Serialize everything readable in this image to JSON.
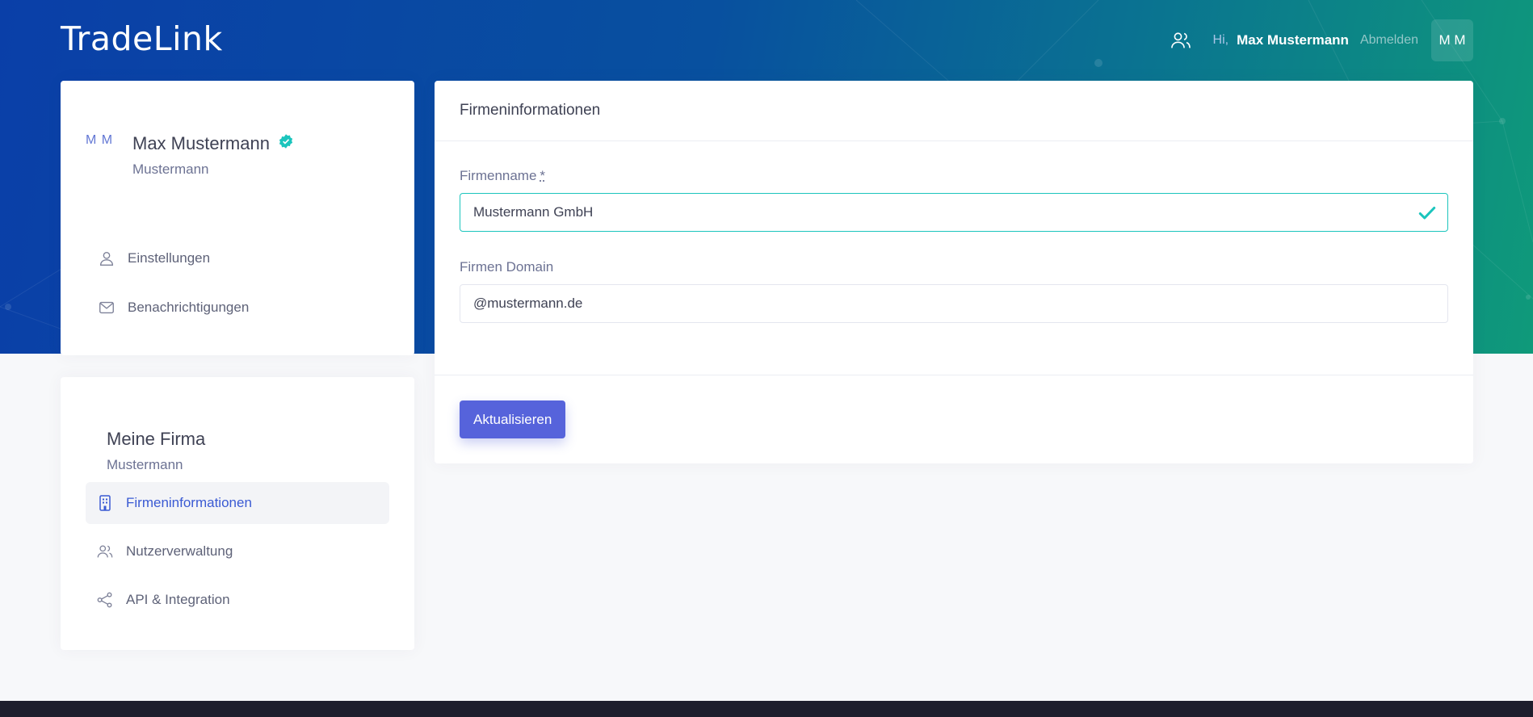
{
  "app": {
    "brand": "TradeLink"
  },
  "topbar": {
    "greeting": "Hi,",
    "user_name": "Max Mustermann",
    "logout_label": "Abmelden",
    "avatar_initials": "M M"
  },
  "profile": {
    "initials": "M M",
    "name": "Max Mustermann",
    "subtitle": "Mustermann",
    "nav": [
      {
        "label": "Einstellungen",
        "icon": "user-icon"
      },
      {
        "label": "Benachrichtigungen",
        "icon": "envelope-icon"
      }
    ]
  },
  "company": {
    "title": "Meine Firma",
    "subtitle": "Mustermann",
    "nav": [
      {
        "label": "Firmeninformationen",
        "icon": "building-icon",
        "active": true
      },
      {
        "label": "Nutzerverwaltung",
        "icon": "users-icon",
        "active": false
      },
      {
        "label": "API & Integration",
        "icon": "share-nodes-icon",
        "active": false
      }
    ]
  },
  "form": {
    "header": "Firmeninformationen",
    "company_name_label": "Firmenname",
    "required_mark": "*",
    "company_name_value": "Mustermann GmbH",
    "domain_label": "Firmen Domain",
    "domain_value": "@mustermann.de",
    "submit_label": "Aktualisieren"
  },
  "colors": {
    "primary": "#5663db",
    "success": "#1bc5bd",
    "active_link": "#3a5ad3",
    "footer": "#1e1e2d"
  }
}
